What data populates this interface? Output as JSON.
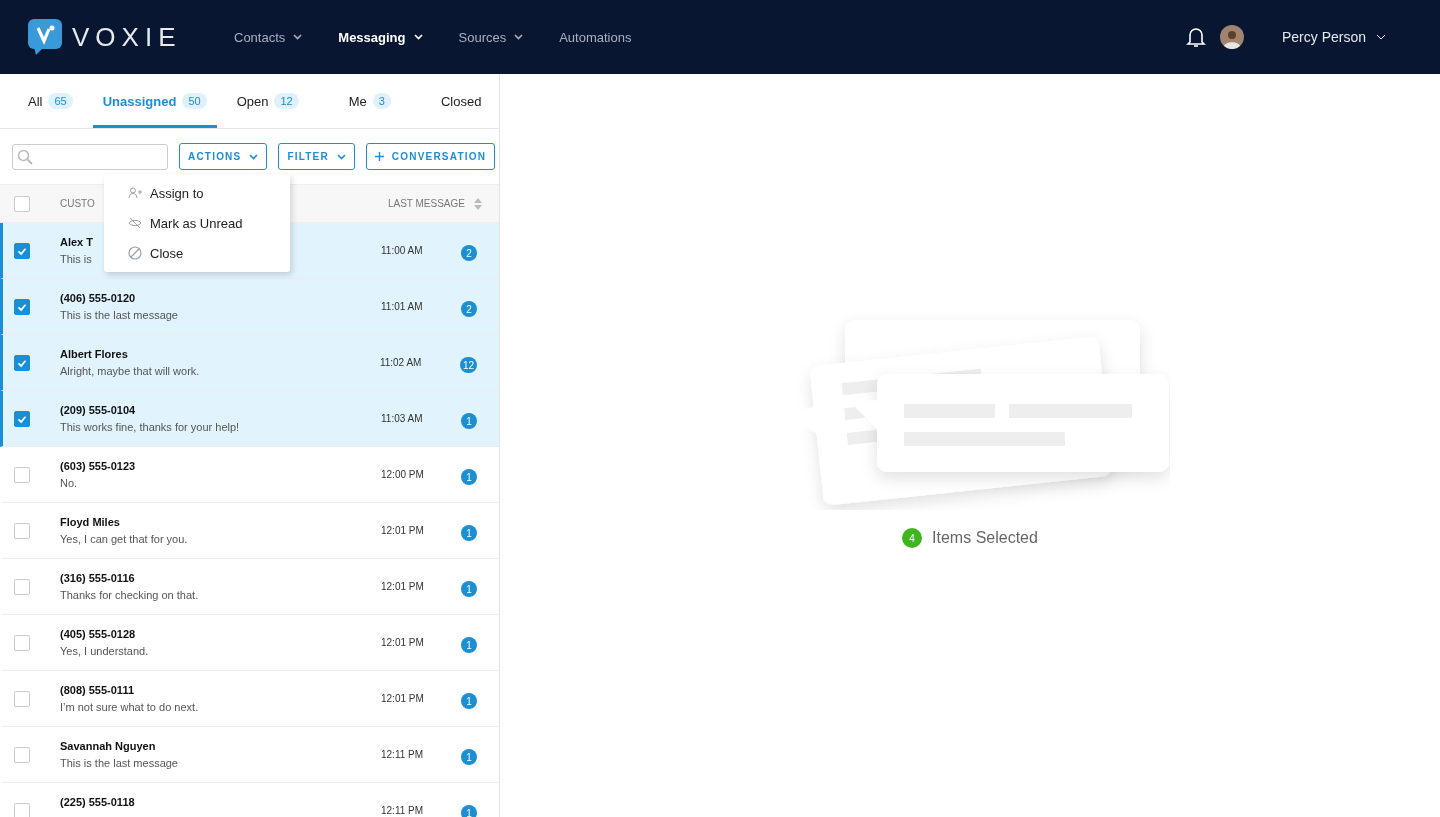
{
  "brand": {
    "name": "VOXIE"
  },
  "nav": [
    {
      "label": "Contacts",
      "dropdown": true,
      "selected": false
    },
    {
      "label": "Messaging",
      "dropdown": true,
      "selected": true
    },
    {
      "label": "Sources",
      "dropdown": true,
      "selected": false
    },
    {
      "label": "Automations",
      "dropdown": false,
      "selected": false
    }
  ],
  "user": {
    "name": "Percy Person"
  },
  "tabs": [
    {
      "label": "All",
      "count": "65",
      "selected": false
    },
    {
      "label": "Unassigned",
      "count": "50",
      "selected": true
    },
    {
      "label": "Open",
      "count": "12",
      "selected": false
    },
    {
      "label": "Me",
      "count": "3",
      "selected": false
    },
    {
      "label": "Closed",
      "selected": false
    }
  ],
  "toolbar": {
    "actions": "ACTIONS",
    "filter": "FILTER",
    "new": "CONVERSATION"
  },
  "table": {
    "select_all": {
      "checked": false
    },
    "columns": [
      "CUSTO",
      "LAST MESSAGE"
    ]
  },
  "actions_menu": [
    {
      "kind": "assign",
      "label": "Assign to"
    },
    {
      "kind": "unread",
      "label": "Mark as Unread"
    },
    {
      "kind": "close",
      "label": "Close"
    }
  ],
  "rows": [
    {
      "name": "Alex T",
      "message": "This is",
      "time": "11:00 AM",
      "unread": "2",
      "selected": true
    },
    {
      "name": "(406) 555-0120",
      "message": "This is the last message",
      "time": "11:01 AM",
      "unread": "2",
      "selected": true
    },
    {
      "name": "Albert Flores",
      "message": "Alright, maybe that will work.",
      "time": "11:02 AM",
      "unread": "12",
      "selected": true
    },
    {
      "name": "(209) 555-0104",
      "message": "This works fine, thanks for your help!",
      "time": "11:03 AM",
      "unread": "1",
      "selected": true
    },
    {
      "name": "(603) 555-0123",
      "message": "No.",
      "time": "12:00 PM",
      "unread": "1",
      "selected": false
    },
    {
      "name": "Floyd Miles",
      "message": "Yes, I can get that for you.",
      "time": "12:01 PM",
      "unread": "1",
      "selected": false
    },
    {
      "name": "(316) 555-0116",
      "message": "Thanks for checking on that.",
      "time": "12:01 PM",
      "unread": "1",
      "selected": false
    },
    {
      "name": "(405) 555-0128",
      "message": "Yes, I understand.",
      "time": "12:01 PM",
      "unread": "1",
      "selected": false
    },
    {
      "name": "(808) 555-0111",
      "message": "I’m not sure what to do next.",
      "time": "12:01 PM",
      "unread": "1",
      "selected": false
    },
    {
      "name": "Savannah Nguyen",
      "message": "This is the last message",
      "time": "12:11 PM",
      "unread": "1",
      "selected": false
    },
    {
      "name": "(225) 555-0118",
      "time": "12:11 PM",
      "unread": "1",
      "selected": false
    }
  ],
  "selection": {
    "count": "4",
    "label": "Items Selected"
  }
}
